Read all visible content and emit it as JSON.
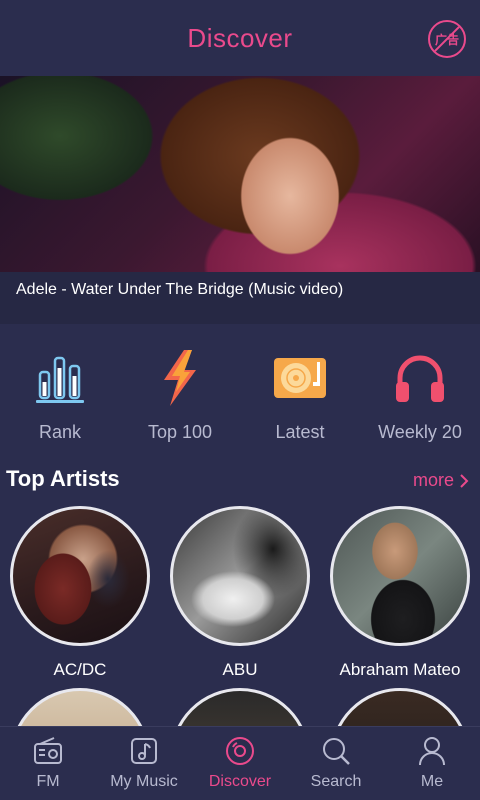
{
  "header": {
    "title": "Discover",
    "ad_icon_label": "广告"
  },
  "banner": {
    "caption": "Adele - Water Under The Bridge (Music video)"
  },
  "categories": [
    {
      "label": "Rank",
      "icon": "rank-bars-icon"
    },
    {
      "label": "Top 100",
      "icon": "lightning-icon"
    },
    {
      "label": "Latest",
      "icon": "turntable-icon"
    },
    {
      "label": "Weekly 20",
      "icon": "headphones-icon"
    }
  ],
  "top_artists": {
    "title": "Top Artists",
    "more_label": "more",
    "artists": [
      {
        "name": "AC/DC"
      },
      {
        "name": "ABU"
      },
      {
        "name": "Abraham Mateo"
      }
    ]
  },
  "bottom_nav": [
    {
      "label": "FM",
      "icon": "radio-icon"
    },
    {
      "label": "My Music",
      "icon": "music-note-icon"
    },
    {
      "label": "Discover",
      "icon": "disc-icon",
      "active": true
    },
    {
      "label": "Search",
      "icon": "search-icon"
    },
    {
      "label": "Me",
      "icon": "person-icon"
    }
  ],
  "colors": {
    "background": "#2b2d4e",
    "accent": "#ea4a8c",
    "muted_text": "#b8bad0"
  }
}
